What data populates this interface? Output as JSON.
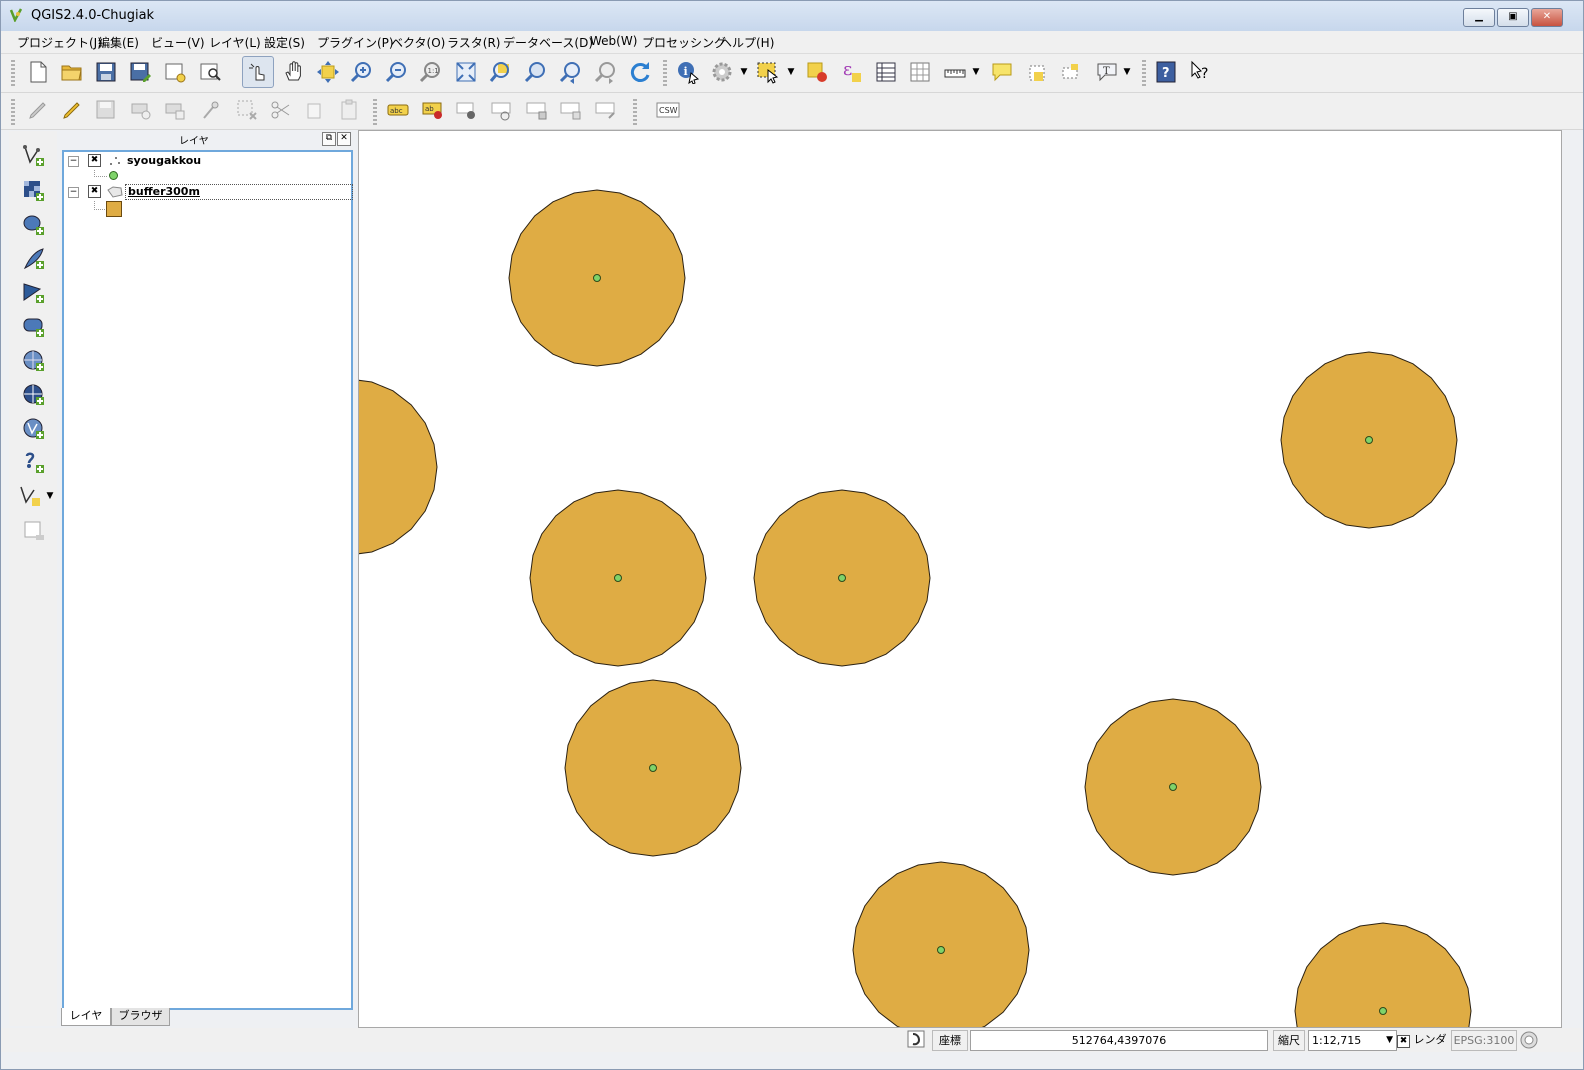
{
  "window": {
    "title": "QGIS2.4.0-Chugiak"
  },
  "menu": [
    "プロジェクト(J)",
    "編集(E)",
    "ビュー(V)",
    "レイヤ(L)",
    "設定(S)",
    "プラグイン(P)",
    "ベクタ(O)",
    "ラスタ(R)",
    "データベース(D)",
    "Web(W)",
    "プロセッシング",
    "ヘルプ(H)"
  ],
  "toolbar": {
    "csw_label": "CSW",
    "abc_label": "abc",
    "ab_label": "ab",
    "tools_row1": [
      "new-project-icon",
      "open-project-icon",
      "save-project-icon",
      "save-as-icon",
      "new-print-composer-icon",
      "composer-manager-icon",
      "touch-zoom-pan-icon",
      "pan-icon",
      "pan-to-selection-icon",
      "zoom-in-icon",
      "zoom-out-icon",
      "zoom-actual-size-icon",
      "zoom-full-icon",
      "zoom-to-selection-icon",
      "zoom-to-layer-icon",
      "zoom-last-icon",
      "zoom-next-icon",
      "refresh-icon",
      "identify-icon",
      "run-action-icon",
      "select-features-icon",
      "deselect-icon",
      "field-calculator-icon",
      "attribute-table-icon",
      "statistics-icon",
      "measure-icon",
      "map-tips-icon",
      "new-bookmark-icon",
      "show-bookmarks-icon",
      "text-annotation-icon",
      "help-icon",
      "whats-this-icon"
    ],
    "tools_row2": [
      "current-edits-icon",
      "toggle-editing-icon",
      "save-edits-icon",
      "add-feature-icon",
      "move-feature-icon",
      "node-tool-icon",
      "delete-selected-icon",
      "cut-features-icon",
      "copy-features-icon",
      "paste-features-icon",
      "label-icon",
      "pin-labels-icon",
      "show-hide-labels-icon",
      "move-label-icon",
      "rotate-label-icon",
      "change-label-icon",
      "csw-icon"
    ]
  },
  "left_tools": [
    "add-vector-layer-icon",
    "add-raster-layer-icon",
    "add-postgis-layer-icon",
    "add-spatialite-layer-icon",
    "add-mssql-layer-icon",
    "add-oracle-layer-icon",
    "add-wms-layer-icon",
    "add-wcs-layer-icon",
    "add-wfs-layer-icon",
    "add-delimited-text-icon",
    "new-shapefile-icon",
    "remove-layer-icon"
  ],
  "layers_panel": {
    "title": "レイヤ",
    "layers": [
      {
        "name": "syougakkou",
        "visible": true,
        "symbol_color": "#7fd36a",
        "type": "point"
      },
      {
        "name": "buffer300m",
        "visible": true,
        "symbol_color": "#dfac44",
        "type": "polygon"
      }
    ],
    "tabs": [
      "レイヤ",
      "ブラウザ"
    ]
  },
  "map": {
    "buffer_fill": "#dfac44",
    "point_fill": "#7fd36a"
  },
  "status": {
    "coord_label": "座標",
    "coordinate": "512764,4397076",
    "scale_label": "縮尺",
    "scale": "1:12,715",
    "render_label": "レンダ",
    "crs": "EPSG:3100"
  }
}
